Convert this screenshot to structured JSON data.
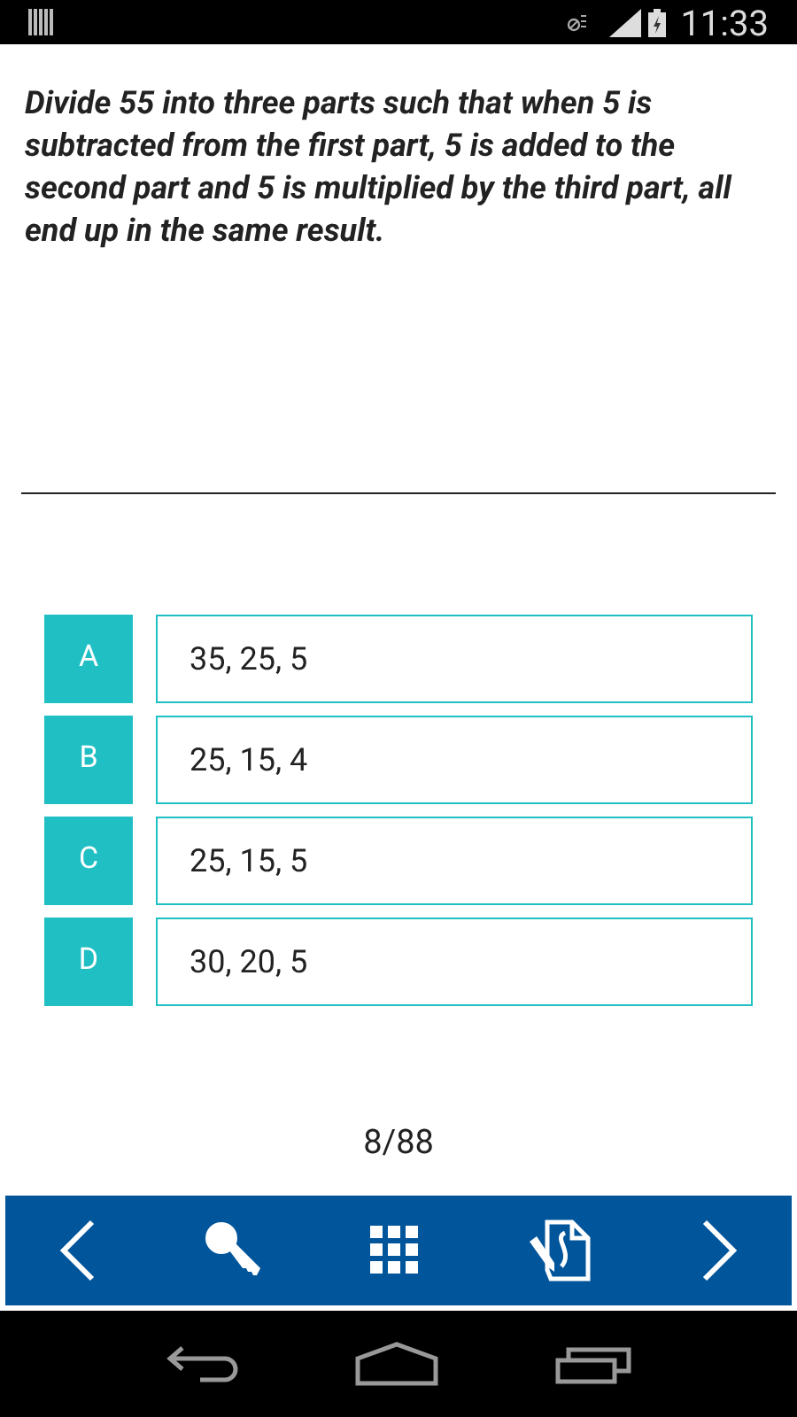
{
  "status_bar": {
    "time": "11:33"
  },
  "question": "Divide 55 into three parts such that when 5 is subtracted from the first part, 5 is added to the second part and 5 is multiplied by the third part, all end up in the same result.",
  "options": [
    {
      "letter": "A",
      "answer": "35, 25, 5"
    },
    {
      "letter": "B",
      "answer": "25, 15, 4"
    },
    {
      "letter": "C",
      "answer": "25, 15, 5"
    },
    {
      "letter": "D",
      "answer": "30, 20, 5"
    }
  ],
  "progress": "8/88"
}
